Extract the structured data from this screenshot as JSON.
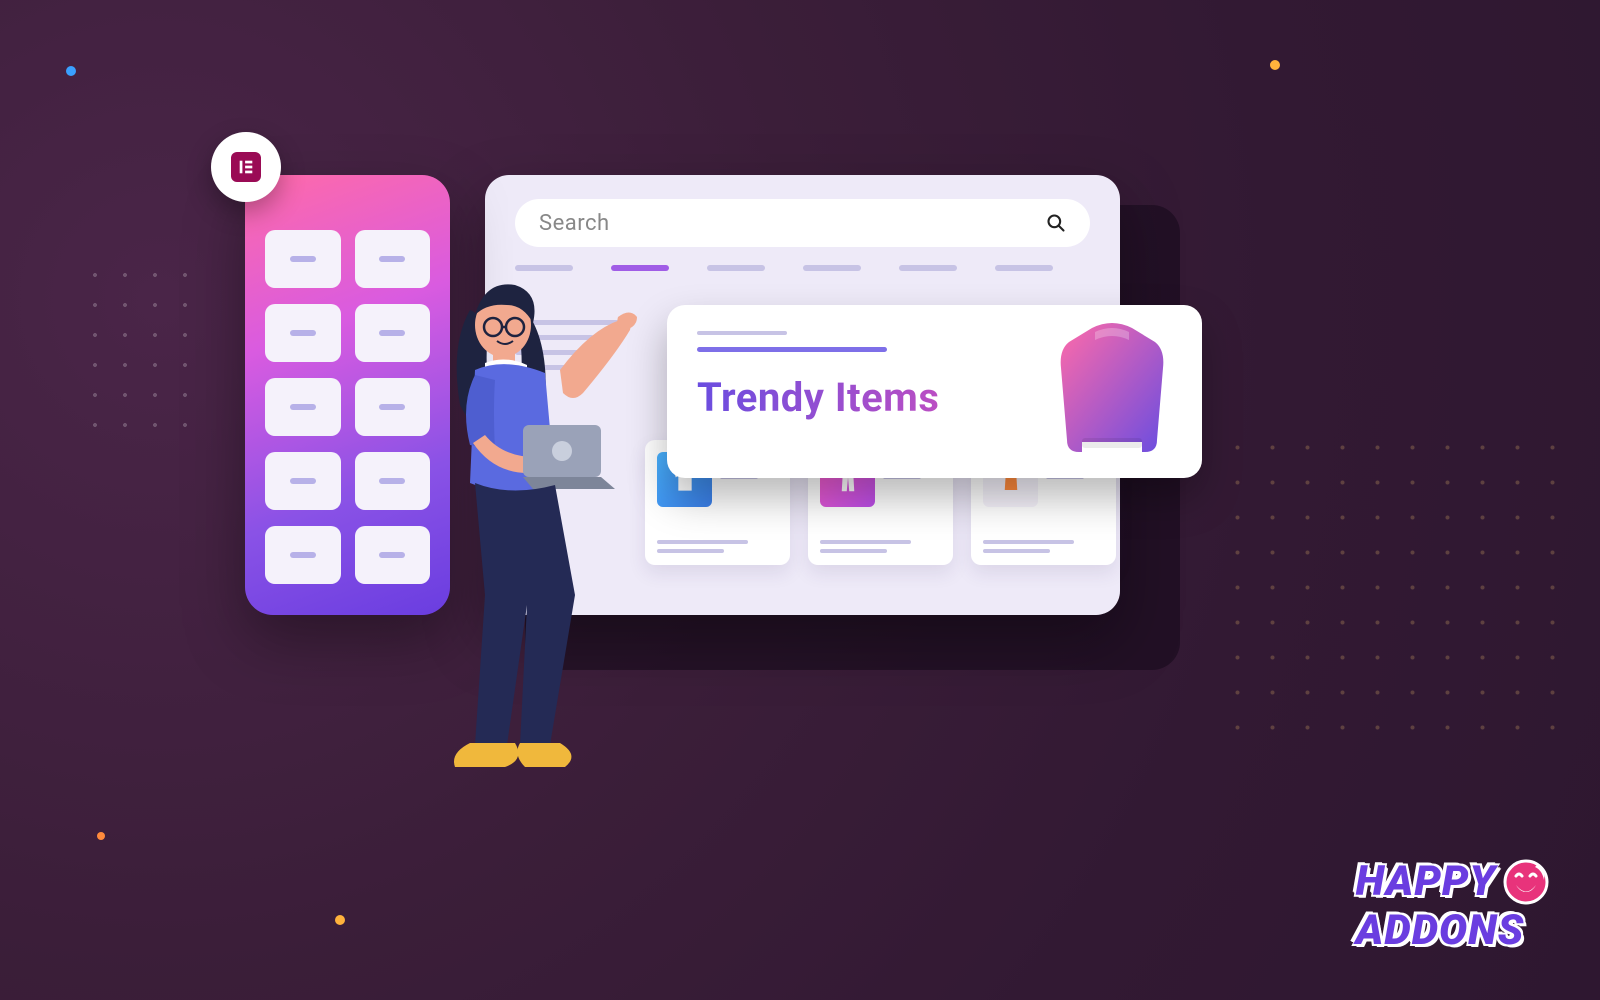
{
  "search": {
    "placeholder": "Search"
  },
  "callout": {
    "title": "Trendy Items"
  },
  "brand": {
    "line1": "HAPPY",
    "line2": "ADDONS"
  },
  "colors": {
    "bg": "#3e1f3a",
    "accent_purple": "#6a3de0",
    "accent_pink": "#ff6aa9",
    "accent_orange": "#ff8a3c"
  },
  "products": [
    {
      "icon": "tshirt",
      "thumb_bg": "linear-gradient(135deg,#49b3ff,#3a7de8)"
    },
    {
      "icon": "pants",
      "thumb_bg": "linear-gradient(135deg,#ff5ec7,#b94de8)"
    },
    {
      "icon": "vest",
      "thumb_bg": "#eeeaf8"
    }
  ]
}
